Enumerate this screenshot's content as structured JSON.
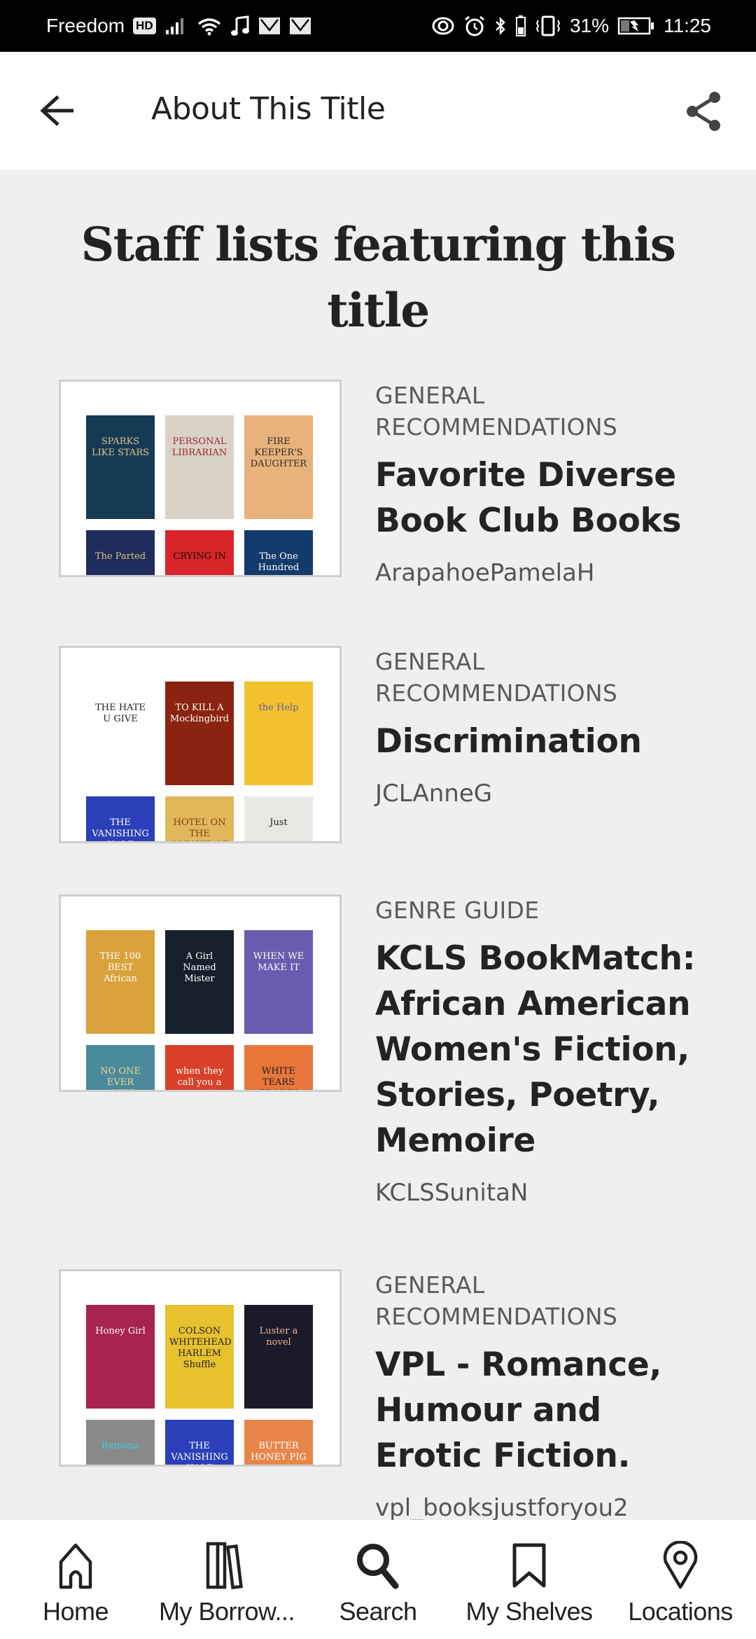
{
  "status_bar": {
    "carrier": "Freedom",
    "hd_badge": "HD",
    "battery_percent": "31%",
    "time": "11:25"
  },
  "header": {
    "title": "About This Title",
    "back_icon": "arrow-left-icon",
    "share_icon": "share-icon"
  },
  "section": {
    "title": "Staff lists featuring this title"
  },
  "lists": [
    {
      "category": "GENERAL RECOMMENDATIONS",
      "title": "Favorite Diverse Book Club Books",
      "author": "ArapahoePamelaH",
      "covers": [
        {
          "title": "SPARKS LIKE STARS",
          "bg": "#173a54",
          "fg": "#d8c48a"
        },
        {
          "title": "PERSONAL LIBRARIAN",
          "bg": "#d9d2c6",
          "fg": "#9b2a30"
        },
        {
          "title": "FIRE KEEPER'S DAUGHTER",
          "bg": "#e7b27b",
          "fg": "#2b2b2b"
        },
        {
          "title": "The Parted",
          "bg": "#1f2c5e",
          "fg": "#d9c27a"
        },
        {
          "title": "CRYING IN",
          "bg": "#d9242a",
          "fg": "#111"
        },
        {
          "title": "The One Hundred",
          "bg": "#123a6a",
          "fg": "#fff"
        }
      ]
    },
    {
      "category": "GENERAL RECOMMENDATIONS",
      "title": "Discrimination",
      "author": "JCLAnneG",
      "covers": [
        {
          "title": "THE HATE U GIVE",
          "bg": "#ffffff",
          "fg": "#222"
        },
        {
          "title": "TO KILL A Mockingbird",
          "bg": "#8a2410",
          "fg": "#fff"
        },
        {
          "title": "the Help",
          "bg": "#f2c12e",
          "fg": "#6b5aa8"
        },
        {
          "title": "THE VANISHING HALF",
          "bg": "#2b3fb8",
          "fg": "#fff"
        },
        {
          "title": "HOTEL ON THE CORNER OF BITTER AND SWEET",
          "bg": "#e0b85a",
          "fg": "#8a3b1a"
        },
        {
          "title": "Just",
          "bg": "#e8e8e4",
          "fg": "#222"
        }
      ]
    },
    {
      "category": "GENRE GUIDE",
      "title": "KCLS BookMatch: African American Women's Fiction, Stories, Poetry, Memoire",
      "author": "KCLSSunitaN",
      "covers": [
        {
          "title": "THE 100 BEST African",
          "bg": "#d9a23a",
          "fg": "#fff"
        },
        {
          "title": "A Girl Named Mister",
          "bg": "#15202c",
          "fg": "#fff"
        },
        {
          "title": "WHEN WE MAKE IT",
          "bg": "#6a5ab0",
          "fg": "#fff"
        },
        {
          "title": "NO ONE EVER ASKED",
          "bg": "#4b8a9a",
          "fg": "#f0d890"
        },
        {
          "title": "when they call you a terrorist",
          "bg": "#d9402a",
          "fg": "#fff"
        },
        {
          "title": "WHITE TEARS BROWN SCARS",
          "bg": "#e8763a",
          "fg": "#222"
        }
      ]
    },
    {
      "category": "GENERAL RECOMMENDATIONS",
      "title": "VPL - Romance, Humour and Erotic Fiction.",
      "author": "vpl_booksjustforyou2",
      "covers": [
        {
          "title": "Honey Girl",
          "bg": "#a8234f",
          "fg": "#fff"
        },
        {
          "title": "COLSON WHITEHEAD HARLEM Shuffle",
          "bg": "#e8c12e",
          "fg": "#222"
        },
        {
          "title": "Luster a novel",
          "bg": "#1a1a2a",
          "fg": "#f0b890"
        },
        {
          "title": "Ramona",
          "bg": "#8a8a8a",
          "fg": "#3ad0e8"
        },
        {
          "title": "THE VANISHING HALF",
          "bg": "#2b3fb8",
          "fg": "#fff"
        },
        {
          "title": "BUTTER HONEY PIG",
          "bg": "#e8864a",
          "fg": "#fff"
        }
      ]
    }
  ],
  "bottom_nav": [
    {
      "label": "Home",
      "icon": "home-icon"
    },
    {
      "label": "My Borrow...",
      "icon": "books-icon"
    },
    {
      "label": "Search",
      "icon": "search-icon"
    },
    {
      "label": "My Shelves",
      "icon": "bookmark-icon"
    },
    {
      "label": "Locations",
      "icon": "location-pin-icon"
    }
  ]
}
